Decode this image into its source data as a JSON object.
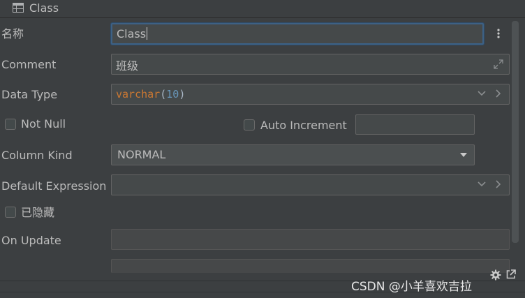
{
  "window": {
    "title": "Class",
    "title_icon": "table-icon"
  },
  "form": {
    "name": {
      "label": "名称",
      "value": "Class"
    },
    "comment": {
      "label": "Comment",
      "value": "班级"
    },
    "data_type": {
      "label": "Data Type",
      "type_keyword": "varchar",
      "open_paren": "(",
      "length": "10",
      "close_paren": ")"
    },
    "not_null": {
      "label": "Not Null",
      "checked": false
    },
    "auto_increment": {
      "label": "Auto Increment",
      "checked": false,
      "value": ""
    },
    "column_kind": {
      "label": "Column Kind",
      "value": "NORMAL"
    },
    "default_expression": {
      "label": "Default Expression",
      "value": ""
    },
    "hidden": {
      "label": "已隐藏",
      "checked": false
    },
    "on_update": {
      "label": "On Update",
      "value": ""
    }
  },
  "icons": {
    "more": "more-vertical-icon",
    "expand": "expand-icon",
    "chevron_down": "chevron-down-icon",
    "chevron_right": "chevron-right-icon",
    "dropdown": "dropdown-triangle-icon",
    "settings": "gear-icon",
    "popout": "popout-icon"
  },
  "colors": {
    "background": "#3c3f41",
    "field_bg": "#45494a",
    "focus_border": "#3d6185",
    "keyword": "#cc7832",
    "number": "#6897bb"
  },
  "watermark": "CSDN @小羊喜欢吉拉"
}
